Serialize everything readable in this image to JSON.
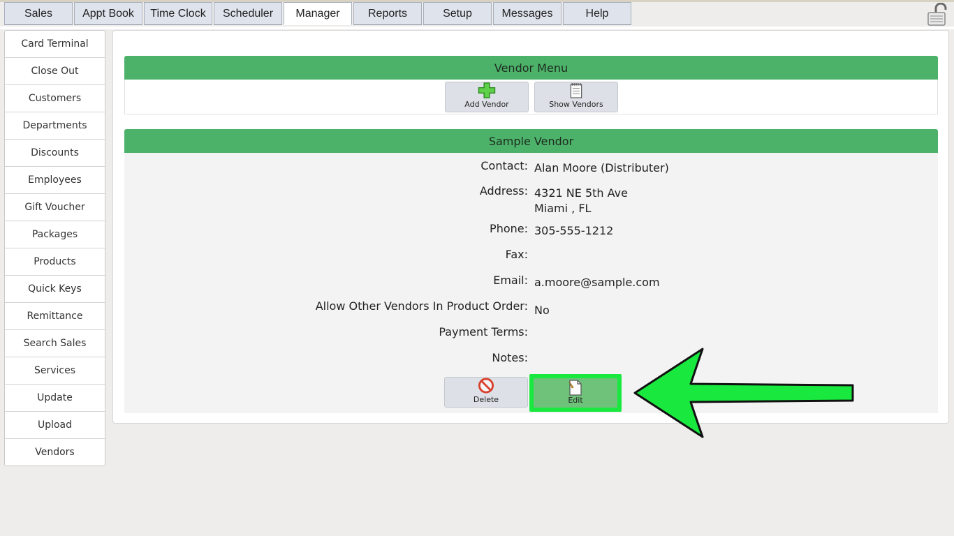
{
  "tabs": [
    {
      "label": "Sales"
    },
    {
      "label": "Appt Book"
    },
    {
      "label": "Time Clock"
    },
    {
      "label": "Scheduler"
    },
    {
      "label": "Manager",
      "active": true
    },
    {
      "label": "Reports"
    },
    {
      "label": "Setup"
    },
    {
      "label": "Messages"
    },
    {
      "label": "Help"
    }
  ],
  "sidebar": {
    "items": [
      {
        "label": "Card Terminal"
      },
      {
        "label": "Close Out"
      },
      {
        "label": "Customers"
      },
      {
        "label": "Departments"
      },
      {
        "label": "Discounts"
      },
      {
        "label": "Employees"
      },
      {
        "label": "Gift Voucher"
      },
      {
        "label": "Packages"
      },
      {
        "label": "Products"
      },
      {
        "label": "Quick Keys"
      },
      {
        "label": "Remittance"
      },
      {
        "label": "Search Sales"
      },
      {
        "label": "Services"
      },
      {
        "label": "Update"
      },
      {
        "label": "Upload"
      },
      {
        "label": "Vendors"
      }
    ]
  },
  "vendor_menu": {
    "title": "Vendor Menu",
    "add_label": "Add Vendor",
    "show_label": "Show Vendors"
  },
  "vendor": {
    "title": "Sample Vendor",
    "contact_label": "Contact:",
    "contact": "Alan Moore (Distributer)",
    "address_label": "Address:",
    "address_line1": "4321 NE 5th Ave",
    "address_line2": "Miami , FL",
    "phone_label": "Phone:",
    "phone": "305-555-1212",
    "fax_label": "Fax:",
    "fax": "",
    "email_label": "Email:",
    "email": "a.moore@sample.com",
    "allow_label": "Allow Other Vendors In Product Order:",
    "allow": "No",
    "terms_label": "Payment Terms:",
    "terms": "",
    "notes_label": "Notes:",
    "notes": "",
    "delete_label": "Delete",
    "edit_label": "Edit"
  },
  "colors": {
    "header_green": "#4cb26a",
    "highlight_green": "#19e83f"
  },
  "icons": {
    "lock": "lock-icon",
    "add": "plus-icon",
    "show": "notepad-icon",
    "delete": "no-entry-icon",
    "edit": "document-pencil-icon",
    "arrow": "arrow-left-icon"
  }
}
